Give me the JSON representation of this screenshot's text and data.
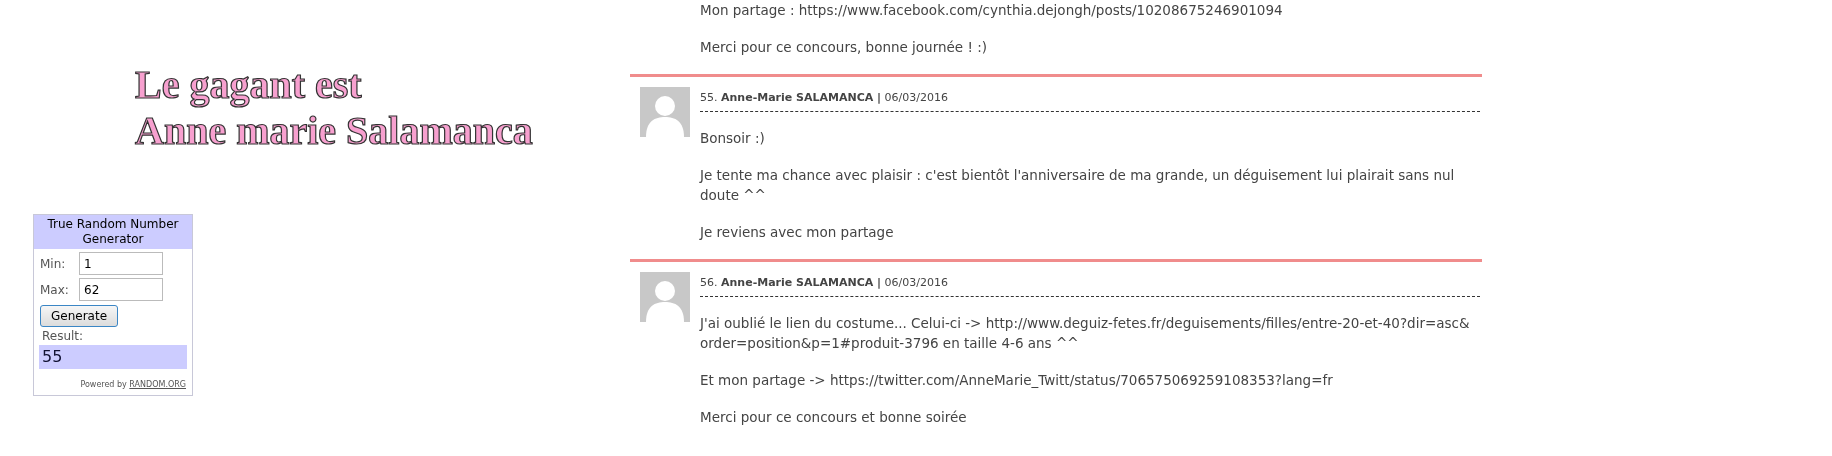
{
  "announcement": {
    "lines": [
      "Le gagant est",
      "Anne marie Salamanca"
    ]
  },
  "rng_widget": {
    "title": "True Random Number Generator",
    "min_label": "Min:",
    "min_value": "1",
    "max_label": "Max:",
    "max_value": "62",
    "button": "Generate",
    "result_label": "Result:",
    "result": "55",
    "powered_by": "Powered by",
    "powered_link": "RANDOM.ORG"
  },
  "previous_comment": {
    "paragraphs": [
      "Mon partage : https://www.facebook.com/cynthia.dejongh/posts/10208675246901094",
      "Merci pour ce concours, bonne journée ! :)"
    ]
  },
  "comments": [
    {
      "meta": "55. **Anne-Marie SALAMANCA |** 06/03/2016",
      "paragraphs": [
        "Bonsoir :)",
        "Je tente ma chance avec plaisir : c'est bientôt l'anniversaire de ma grande, un déguisement lui plairait sans nul doute ^^",
        "Je reviens avec mon partage"
      ]
    },
    {
      "meta": "56. **Anne-Marie SALAMANCA |** 06/03/2016",
      "paragraphs": [
        "J'ai oublié le lien du costume... Celui-ci -> http://www.deguiz-fetes.fr/deguisements/filles/entre-20-et-40?dir=asc& order=position&p=1#produit-3796 en taille 4-6 ans ^^",
        "Et mon partage -> https://twitter.com/AnneMarie_Twitt/status/706575069259108353?lang=fr",
        "Merci pour ce concours et bonne soirée"
      ]
    }
  ]
}
